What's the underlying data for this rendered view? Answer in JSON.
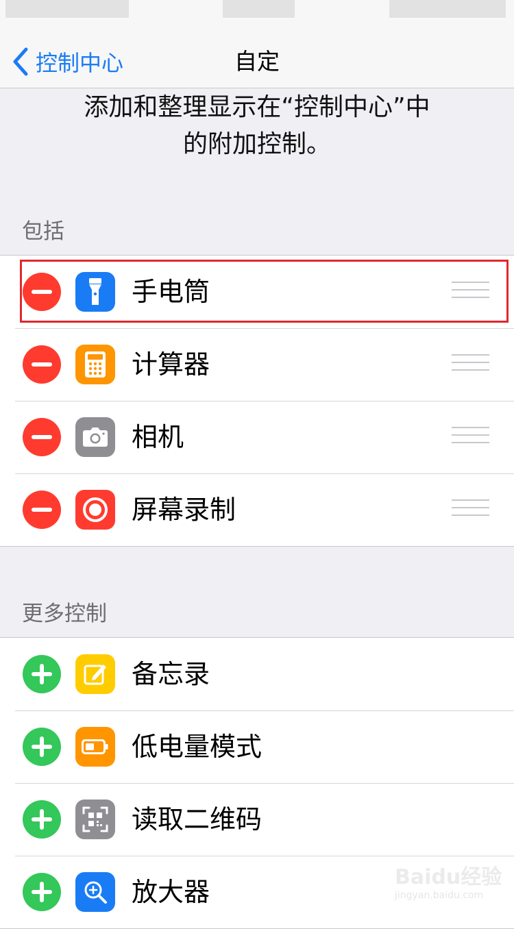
{
  "nav": {
    "back_label": "控制中心",
    "title": "自定"
  },
  "description": {
    "line1": "添加和整理显示在“控制中心”中",
    "line2": "的附加控制。"
  },
  "included": {
    "header": "包括",
    "items": [
      {
        "label": "手电筒",
        "icon": "flashlight-icon",
        "color": "#1a7cf5"
      },
      {
        "label": "计算器",
        "icon": "calculator-icon",
        "color": "#ff9500"
      },
      {
        "label": "相机",
        "icon": "camera-icon",
        "color": "#8e8e93"
      },
      {
        "label": "屏幕录制",
        "icon": "screen-record-icon",
        "color": "#ff3b30"
      }
    ]
  },
  "more": {
    "header": "更多控制",
    "items": [
      {
        "label": "备忘录",
        "icon": "notes-icon",
        "color": "#ffcc00"
      },
      {
        "label": "低电量模式",
        "icon": "low-power-icon",
        "color": "#ff9500"
      },
      {
        "label": "读取二维码",
        "icon": "qr-code-icon",
        "color": "#8e8e93"
      },
      {
        "label": "放大器",
        "icon": "magnifier-icon",
        "color": "#1a7cf5"
      }
    ]
  },
  "watermark": {
    "logo": "Baidu经验",
    "url": "jingyan.baidu.com"
  },
  "colors": {
    "accent": "#1a7cf5",
    "remove": "#ff3b30",
    "add": "#34c759",
    "highlight": "#e0282e"
  }
}
